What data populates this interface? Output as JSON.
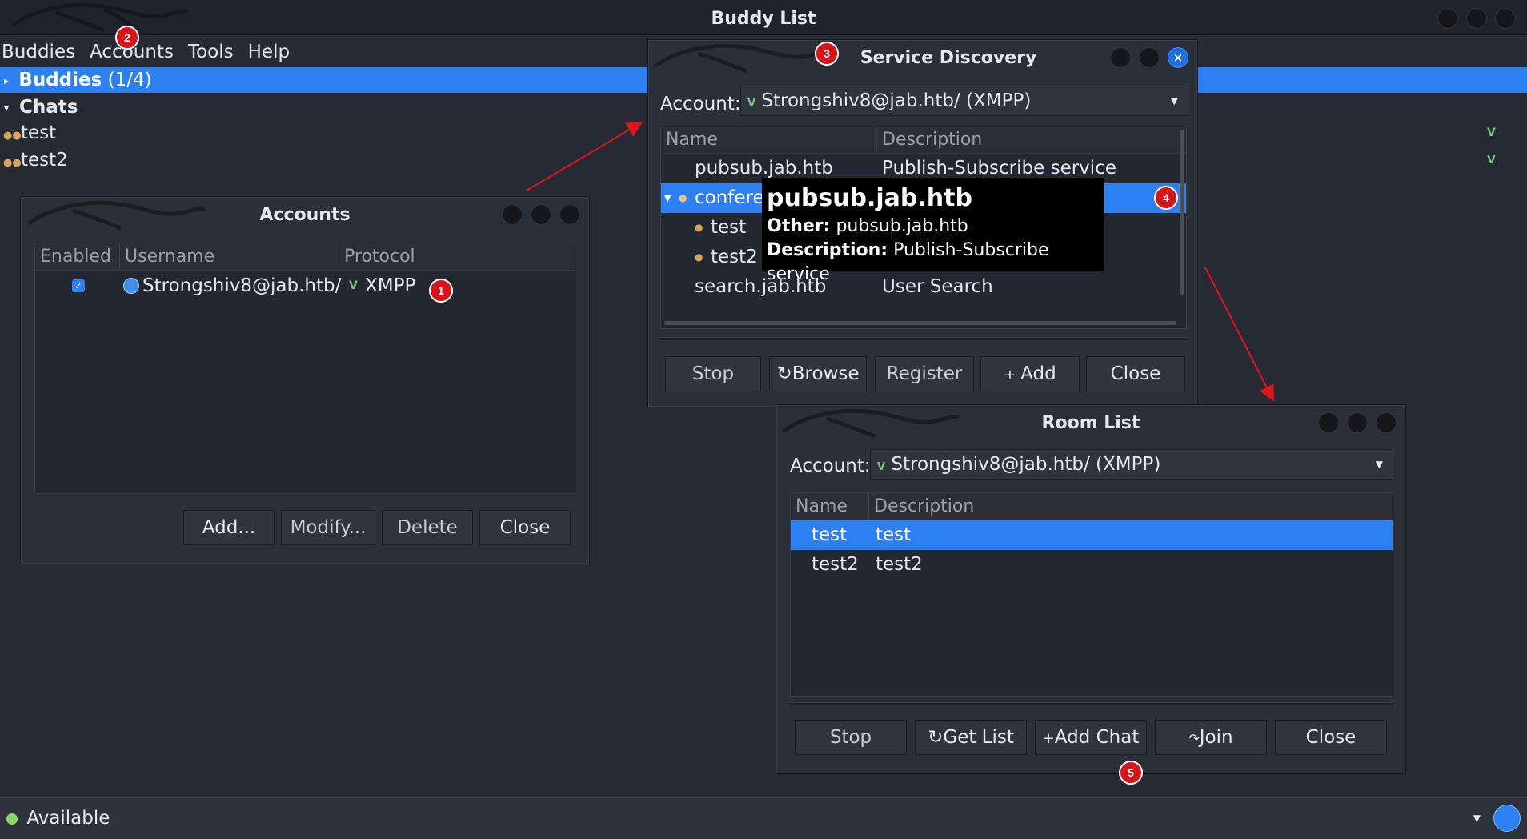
{
  "window": {
    "title": "Buddy List"
  },
  "menu": [
    "Buddies",
    "Accounts",
    "Tools",
    "Help"
  ],
  "tree": {
    "buddies_label": "Buddies",
    "buddies_count": "(1/4)",
    "chats_label": "Chats",
    "chats": [
      "test",
      "test2"
    ]
  },
  "accounts_dialog": {
    "title": "Accounts",
    "columns": [
      "Enabled",
      "Username",
      "Protocol"
    ],
    "row": {
      "enabled": true,
      "username": "Strongshiv8@jab.htb/",
      "protocol": "XMPP"
    },
    "buttons": [
      "Add...",
      "Modify...",
      "Delete",
      "Close"
    ]
  },
  "service_discovery": {
    "title": "Service Discovery",
    "account_label": "Account:",
    "account_value": "Strongshiv8@jab.htb/ (XMPP)",
    "columns": [
      "Name",
      "Description"
    ],
    "rows": [
      {
        "name": "pubsub.jab.htb",
        "description": "Publish-Subscribe service"
      },
      {
        "name": "confere",
        "description": ""
      },
      {
        "name": "test",
        "description": ""
      },
      {
        "name": "test2",
        "description": ""
      },
      {
        "name": "search.jab.htb",
        "description": "User Search"
      }
    ],
    "buttons": {
      "stop": "Stop",
      "browse": "Browse",
      "register": "Register",
      "add": "Add",
      "close": "Close"
    }
  },
  "tooltip": {
    "title": "pubsub.jab.htb",
    "other_label": "Other:",
    "other_value": "pubsub.jab.htb",
    "description_label": "Description:",
    "description_value": "Publish-Subscribe service"
  },
  "room_list": {
    "title": "Room List",
    "account_label": "Account:",
    "account_value": "Strongshiv8@jab.htb/ (XMPP)",
    "columns": [
      "Name",
      "Description"
    ],
    "rows": [
      {
        "name": "test",
        "description": "test"
      },
      {
        "name": "test2",
        "description": "test2"
      }
    ],
    "buttons": {
      "stop": "Stop",
      "get_list": "Get List",
      "add_chat": "Add Chat",
      "join": "Join",
      "close": "Close"
    }
  },
  "status": {
    "value": "Available"
  },
  "badges": [
    "1",
    "2",
    "3",
    "4",
    "5"
  ],
  "colors": {
    "selection": "#2c80f2",
    "badge": "#d8141b",
    "arrow": "#e0141b",
    "background": "#262a34"
  }
}
